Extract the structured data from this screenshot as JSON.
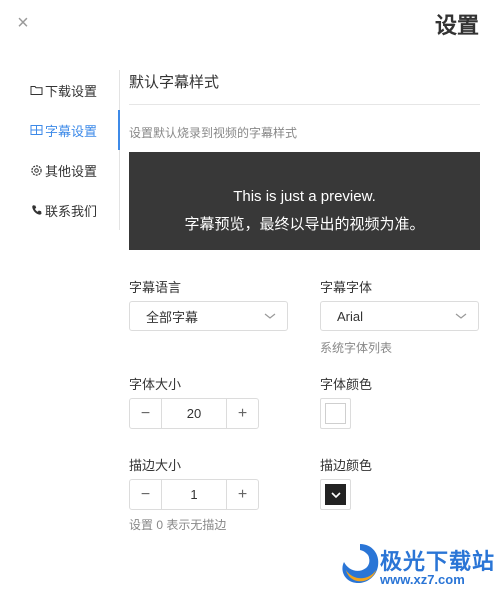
{
  "window": {
    "title": "设置",
    "close_glyph": "×"
  },
  "sidebar": {
    "items": [
      {
        "label": "下载设置",
        "icon": "folder-icon",
        "active": false
      },
      {
        "label": "字幕设置",
        "icon": "subtitle-icon",
        "active": true
      },
      {
        "label": "其他设置",
        "icon": "gear-icon",
        "active": false
      },
      {
        "label": "联系我们",
        "icon": "phone-icon",
        "active": false
      }
    ]
  },
  "section": {
    "title": "默认字幕样式",
    "description": "设置默认烧录到视频的字幕样式"
  },
  "preview": {
    "line1": "This is just a preview.",
    "line2": "字幕预览，最终以导出的视频为准。"
  },
  "subtitle_language": {
    "label": "字幕语言",
    "value": "全部字幕"
  },
  "subtitle_font": {
    "label": "字幕字体",
    "value": "Arial",
    "hint": "系统字体列表"
  },
  "font_size": {
    "label": "字体大小",
    "value": "20",
    "minus": "−",
    "plus": "+"
  },
  "font_color": {
    "label": "字体颜色",
    "color": "#ffffff"
  },
  "stroke_size": {
    "label": "描边大小",
    "value": "1",
    "minus": "−",
    "plus": "+",
    "hint": "设置 0 表示无描边"
  },
  "stroke_color": {
    "label": "描边颜色",
    "color": "#222222"
  },
  "watermark": {
    "brand": "极光下载站",
    "url": "www.xz7.com"
  },
  "colors": {
    "accent": "#3d8ae8",
    "preview_bg": "#383838",
    "watermark": "#2a75d6"
  }
}
